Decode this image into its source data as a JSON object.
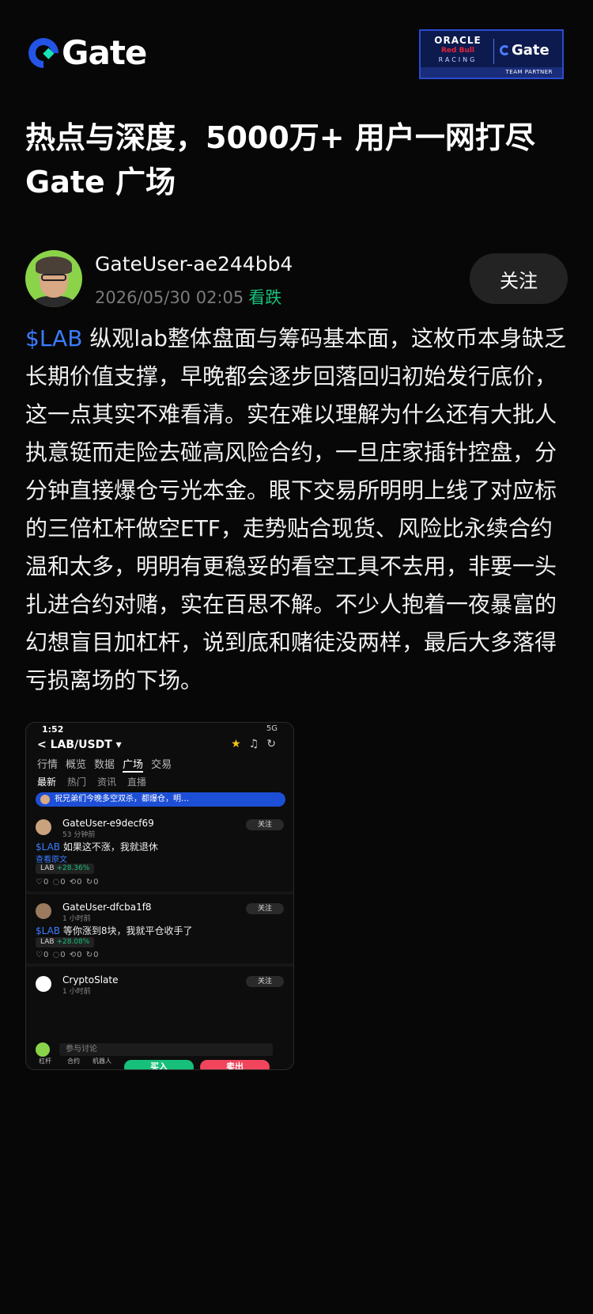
{
  "header": {
    "logo_text": "Gate",
    "partner": {
      "oracle": "ORACLE",
      "redbull": "Red Bull",
      "racing": "RACING",
      "gate": "Gate",
      "footer": "TEAM PARTNER"
    }
  },
  "headline": "热点与深度，5000万+ 用户一网打尽 Gate 广场",
  "post": {
    "author": "GateUser-ae244bb4",
    "timestamp": "2026/05/30 02:05",
    "sentiment": "看跌",
    "follow_label": "关注",
    "tag": "$LAB",
    "body": " 纵观lab整体盘面与筹码基本面，这枚币本身缺乏长期价值支撑，早晚都会逐步回落回归初始发行底价，这一点其实不难看清。实在难以理解为什么还有大批人执意铤而走险去碰高风险合约，一旦庄家插针控盘，分分钟直接爆仓亏光本金。眼下交易所明明上线了对应标的三倍杠杆做空ETF，走势贴合现货、风险比永续合约温和太多，明明有更稳妥的看空工具不去用，非要一头扎进合约对赌，实在百思不解。不少人抱着一夜暴富的幻想盲目加杠杆，说到底和赌徒没两样，最后大多落得亏损离场的下场。"
  },
  "screenshot": {
    "time": "1:52",
    "status": "5G",
    "pair": "LAB/USDT ▾",
    "tabs": [
      "行情",
      "概览",
      "数据",
      "广场",
      "交易"
    ],
    "subtabs": [
      "最新",
      "热门",
      "资讯",
      "直播"
    ],
    "banner": "祝兄弟们今晚多空双杀，都爆仓，明…",
    "posts": [
      {
        "user": "GateUser-e9decf69",
        "sub": "53 分钟前",
        "tag": "$LAB",
        "text": " 如果这不涨，我就退休",
        "more": "查看原文",
        "chip_label": "LAB",
        "chip_change": "+28.36%",
        "actions": "♡0   ◌0   ⟲0   ↻0",
        "follow": "关注"
      },
      {
        "user": "GateUser-dfcba1f8",
        "sub": "1 小时前",
        "tag": "$LAB",
        "text": " 等你涨到8块，我就平仓收手了",
        "chip_label": "LAB",
        "chip_change": "+28.08%",
        "actions": "♡0   ◌0   ⟲0   ↻0",
        "follow": "关注"
      },
      {
        "user": "CryptoSlate",
        "sub": "1 小时前",
        "follow": "关注"
      }
    ],
    "input_placeholder": "参与讨论",
    "bottom": [
      "杠杆",
      "合约",
      "机器人"
    ],
    "buy": "买入",
    "sell": "卖出"
  }
}
